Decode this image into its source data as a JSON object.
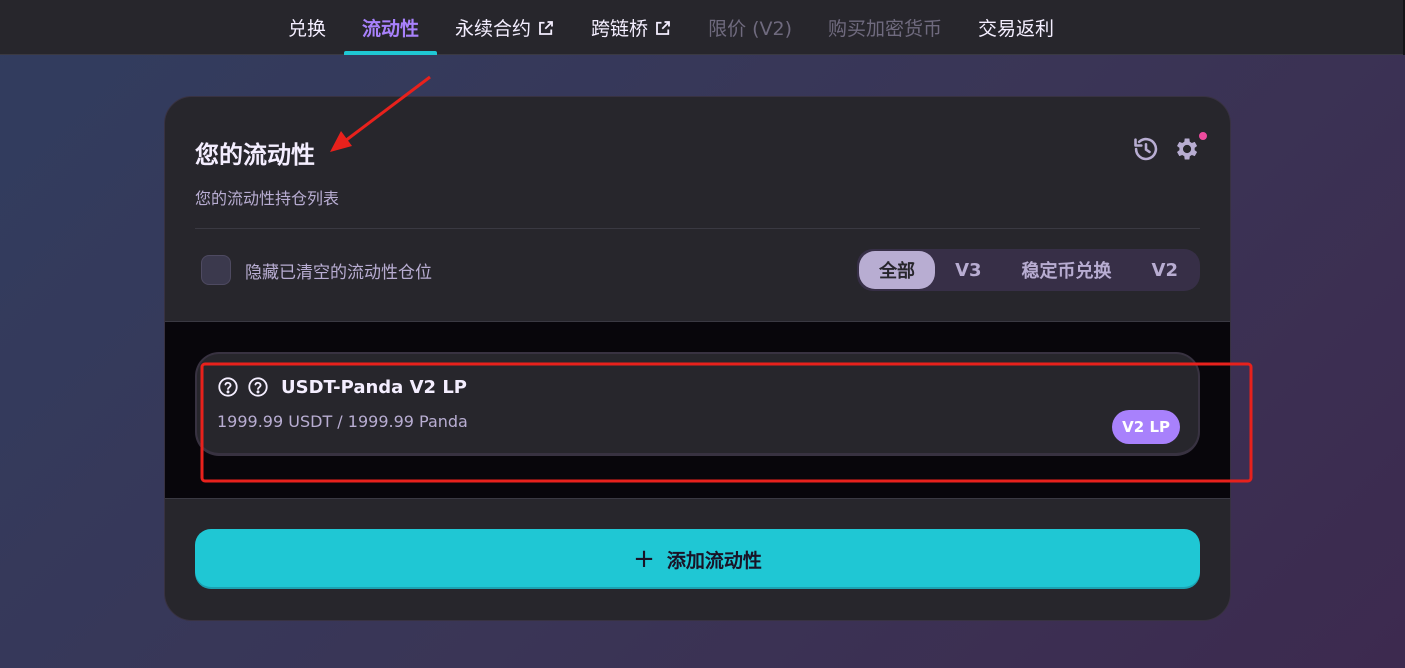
{
  "nav": {
    "items": [
      {
        "label": "兑换"
      },
      {
        "label": "流动性"
      },
      {
        "label": "永续合约"
      },
      {
        "label": "跨链桥"
      },
      {
        "label": "限价 (V2)"
      },
      {
        "label": "购买加密货币"
      },
      {
        "label": "交易返利"
      }
    ],
    "active_index": 1
  },
  "liquidity": {
    "title": "您的流动性",
    "subtitle": "您的流动性持仓列表",
    "hide_closed_label": "隐藏已清空的流动性仓位",
    "hide_closed_checked": false,
    "filters": [
      "全部",
      "V3",
      "稳定币兑换",
      "V2"
    ],
    "active_filter": "全部",
    "positions": [
      {
        "name": "USDT-Panda V2 LP",
        "amounts": "1999.99 USDT / 1999.99 Panda",
        "badge": "V2 LP"
      }
    ],
    "add_button_label": "添加流动性"
  },
  "colors": {
    "accent_cyan": "#1fc7d4",
    "accent_purple": "#a881fc",
    "card_bg": "#27262c",
    "annotation_red": "#e8211c",
    "notification_pink": "#ed4b9e"
  },
  "icons": [
    "history-icon",
    "gear-icon",
    "question-icon",
    "external-link-icon",
    "plus-icon"
  ]
}
